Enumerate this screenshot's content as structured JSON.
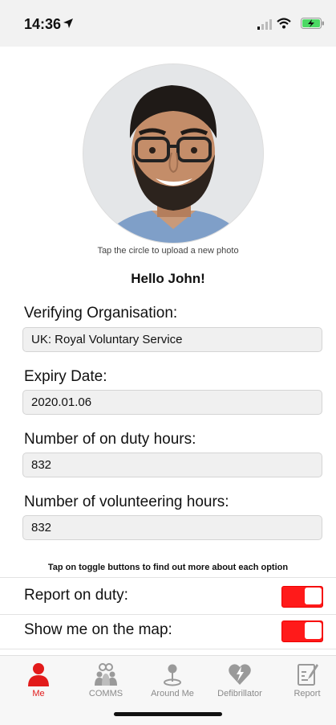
{
  "status": {
    "time": "14:36"
  },
  "profile": {
    "photo_hint": "Tap the circle to upload a new photo",
    "greeting": "Hello John!"
  },
  "fields": [
    {
      "label": "Verifying Organisation:",
      "value": "UK: Royal Voluntary Service"
    },
    {
      "label": "Expiry Date:",
      "value": "2020.01.06"
    },
    {
      "label": "Number of on duty hours:",
      "value": "832"
    },
    {
      "label": "Number of volunteering hours:",
      "value": "832"
    }
  ],
  "toggles": {
    "hint": "Tap on toggle buttons to find out more about each option",
    "items": [
      {
        "label": "Report on duty:",
        "on": true
      },
      {
        "label": "Show me on the map:",
        "on": true
      }
    ]
  },
  "tabs": [
    {
      "label": "Me",
      "icon": "person-icon",
      "active": true
    },
    {
      "label": "COMMS",
      "icon": "people-group-icon",
      "active": false
    },
    {
      "label": "Around Me",
      "icon": "map-pin-icon",
      "active": false
    },
    {
      "label": "Defibrillator",
      "icon": "heart-bolt-icon",
      "active": false
    },
    {
      "label": "Report",
      "icon": "report-pencil-icon",
      "active": false
    }
  ],
  "colors": {
    "accent": "#e21b1b",
    "toggle_on": "#ff1a1a",
    "inactive": "#8a8a8a"
  }
}
